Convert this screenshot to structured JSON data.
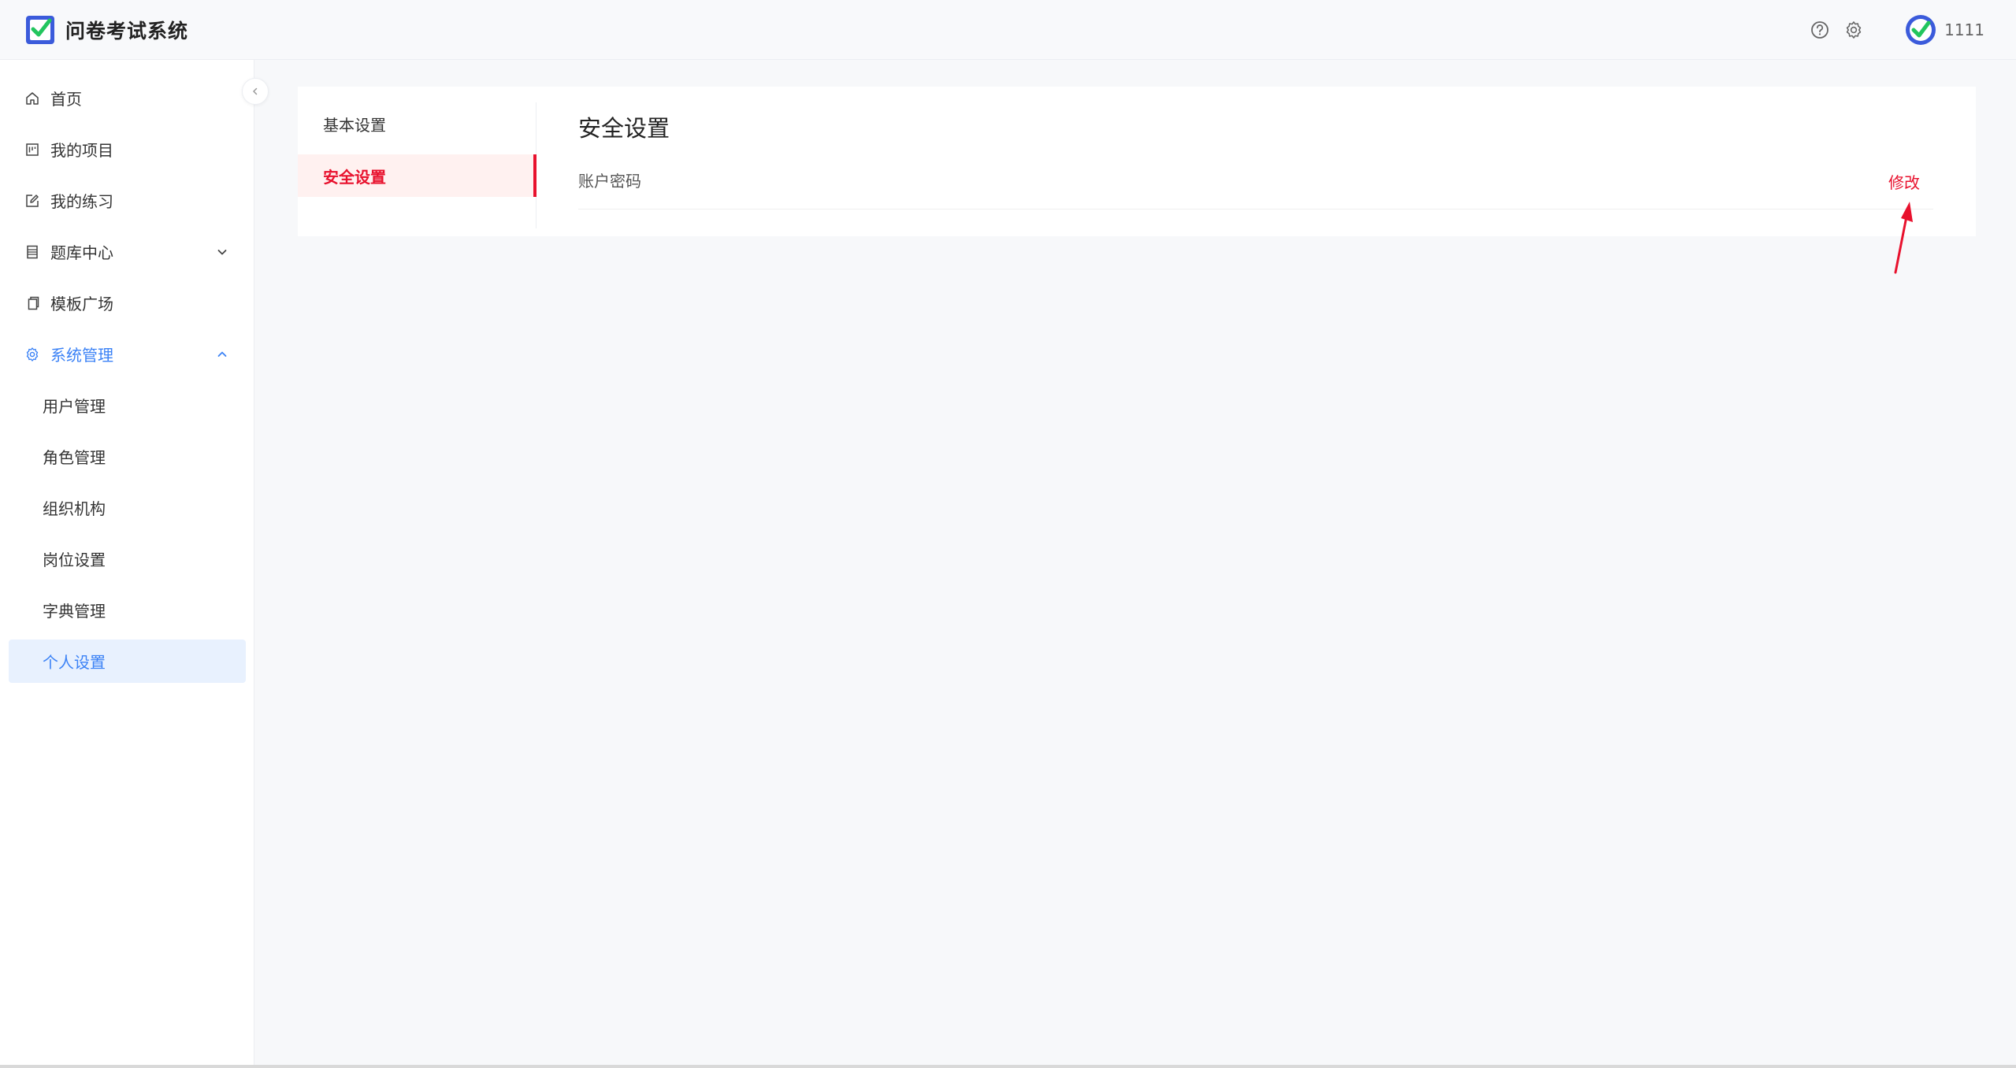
{
  "header": {
    "title": "问卷考试系统",
    "logo_icon": "check-square-icon",
    "help_icon": "question-circle-icon",
    "settings_icon": "gear-icon",
    "username": "1111"
  },
  "sidebar": {
    "collapse_icon": "chevron-left-icon",
    "items": [
      {
        "label": "首页",
        "icon": "home-icon"
      },
      {
        "label": "我的项目",
        "icon": "project-icon"
      },
      {
        "label": "我的练习",
        "icon": "edit-icon"
      },
      {
        "label": "题库中心",
        "icon": "list-icon",
        "arrow": "chevron-down-icon"
      },
      {
        "label": "模板广场",
        "icon": "copy-icon"
      },
      {
        "label": "系统管理",
        "icon": "gear-icon",
        "arrow": "chevron-up-icon"
      }
    ],
    "sub_items": [
      {
        "label": "用户管理"
      },
      {
        "label": "角色管理"
      },
      {
        "label": "组织机构"
      },
      {
        "label": "岗位设置"
      },
      {
        "label": "字典管理"
      },
      {
        "label": "个人设置"
      }
    ]
  },
  "settings": {
    "tabs": [
      {
        "label": "基本设置"
      },
      {
        "label": "安全设置"
      }
    ],
    "section_title": "安全设置",
    "rows": [
      {
        "label": "账户密码",
        "action": "修改"
      }
    ]
  },
  "colors": {
    "accent_blue": "#3b82f6",
    "accent_red": "#e8112d",
    "logo_blue": "#3b5bdb",
    "logo_green": "#22c55e"
  }
}
